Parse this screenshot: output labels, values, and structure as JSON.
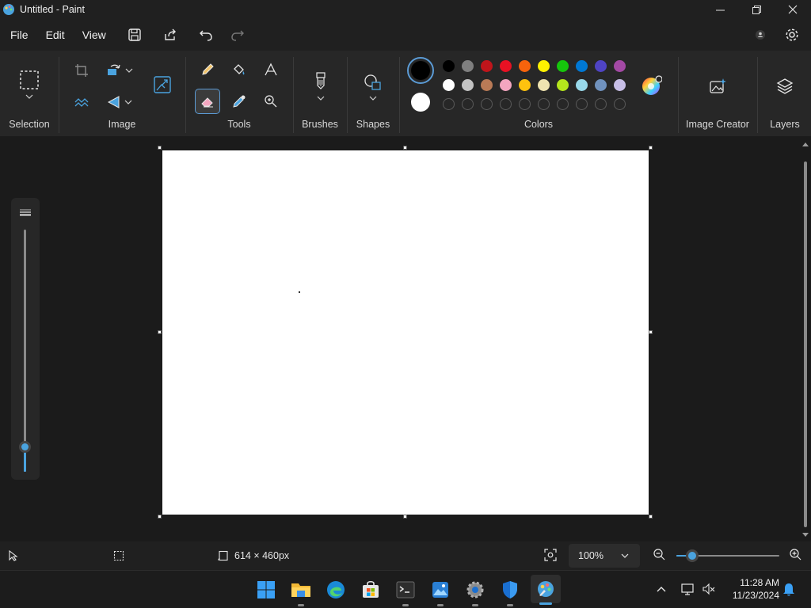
{
  "window": {
    "title": "Untitled - Paint",
    "controls": [
      "minimize-icon",
      "restore-icon",
      "close-icon"
    ]
  },
  "menu": {
    "items": [
      "File",
      "Edit",
      "View"
    ],
    "quick_actions": [
      "save-icon",
      "share-icon",
      "undo-icon",
      "redo-icon"
    ],
    "right_icons": [
      "account-icon",
      "settings-icon"
    ]
  },
  "ribbon": {
    "groups": {
      "selection": "Selection",
      "image": "Image",
      "tools": "Tools",
      "brushes": "Brushes",
      "shapes": "Shapes",
      "colors": "Colors",
      "image_creator": "Image Creator",
      "layers": "Layers"
    },
    "active_tool": "eraser",
    "primary_color": "#000000",
    "secondary_color": "#ffffff",
    "palette_row1": [
      "#000000",
      "#7f7f7f",
      "#c0151b",
      "#e81123",
      "#f7630c",
      "#fff100",
      "#16c60c",
      "#0078d4",
      "#4f44c4",
      "#a349a4"
    ],
    "palette_row2": [
      "#ffffff",
      "#c3c3c3",
      "#b97a56",
      "#f4a6c0",
      "#ffc20e",
      "#efe4b0",
      "#b5e61d",
      "#99d9ea",
      "#7092be",
      "#c8bfe7"
    ]
  },
  "status": {
    "canvas_size": "614 × 460px",
    "zoom": "100%",
    "zoom_slider_level": 0.15
  },
  "taskbar": {
    "apps": [
      "start-icon",
      "file-explorer-icon",
      "edge-icon",
      "store-icon",
      "terminal-icon",
      "photos-icon",
      "settings-icon",
      "defender-icon",
      "paint-icon"
    ],
    "time": "11:28 AM",
    "date": "11/23/2024"
  }
}
